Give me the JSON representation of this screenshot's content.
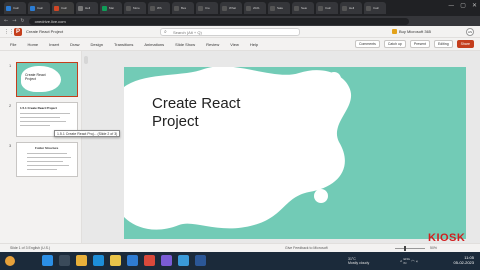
{
  "browser": {
    "tabs": [
      {
        "label": "Calc",
        "color": "#2b7cd3"
      },
      {
        "label": "Calc",
        "color": "#2b7cd3"
      },
      {
        "label": "Calc",
        "color": "#d24726"
      },
      {
        "label": "Hell",
        "color": "#777777"
      },
      {
        "label": "Mai",
        "color": "#0f9d58"
      },
      {
        "label": "More",
        "color": "#555555"
      },
      {
        "label": "Wh",
        "color": "#555555"
      },
      {
        "label": "Bes",
        "color": "#555555"
      },
      {
        "label": "Cre",
        "color": "#555555"
      },
      {
        "label": "What",
        "color": "#555555"
      },
      {
        "label": "2021",
        "color": "#555555"
      },
      {
        "label": "Sale",
        "color": "#555555"
      },
      {
        "label": "Sear",
        "color": "#555555"
      },
      {
        "label": "Calc",
        "color": "#555555"
      },
      {
        "label": "Hell",
        "color": "#555555"
      },
      {
        "label": "Calc",
        "color": "#555555"
      }
    ],
    "url": "onedrive.live.com",
    "window_controls": [
      "—",
      "▢",
      "✕"
    ]
  },
  "app": {
    "doc_title": "Create React Project",
    "search_placeholder": "Search (Alt + Q)",
    "buy_label": "Buy Microsoft 365",
    "avatar_initials": "AS",
    "accent": "#c43e1c"
  },
  "ribbon": {
    "tabs": [
      "File",
      "Home",
      "Insert",
      "Draw",
      "Design",
      "Transitions",
      "Animations",
      "Slide Show",
      "Review",
      "View",
      "Help"
    ],
    "buttons": {
      "comments": "Comments",
      "catch_up": "Catch up",
      "present": "Present",
      "editing": "Editing",
      "share": "Share"
    }
  },
  "thumbnails": {
    "slides": [
      {
        "number": "1",
        "title": "Create React Project"
      },
      {
        "number": "2",
        "title": "1.5.1 Create React Project"
      },
      {
        "number": "3",
        "title": "Folder Structure"
      }
    ],
    "tooltip": "1.5.1 Create React Proj... (Slide 2 of 3)"
  },
  "slide": {
    "title_line1": "Create React",
    "title_line2": "Project",
    "bg_color": "#72cbb6"
  },
  "status": {
    "left": "Slide 1 of 3    English (U.S.)",
    "middle": "Give Feedback to Microsoft",
    "zoom": "50%"
  },
  "watermark": "KIOSK",
  "taskbar": {
    "icons": [
      {
        "name": "windows-icon",
        "color": "#2b8fe6"
      },
      {
        "name": "search-icon",
        "color": "#3a4a5a"
      },
      {
        "name": "chrome-icon",
        "color": "#e8b03a"
      },
      {
        "name": "edge-icon",
        "color": "#1d8ed8"
      },
      {
        "name": "files-icon",
        "color": "#e8c44a"
      },
      {
        "name": "vscode-icon",
        "color": "#2f7cd3"
      },
      {
        "name": "chrome-icon-2",
        "color": "#d9493b"
      },
      {
        "name": "app-icon",
        "color": "#7a5cd6"
      },
      {
        "name": "store-icon",
        "color": "#3a9ad9"
      },
      {
        "name": "word-icon",
        "color": "#2b5797"
      }
    ],
    "weather_temp": "31°C",
    "weather_desc": "Mostly cloudy",
    "lang": "ENG\nIN",
    "time": "11:05",
    "date": "05-02-2023"
  }
}
